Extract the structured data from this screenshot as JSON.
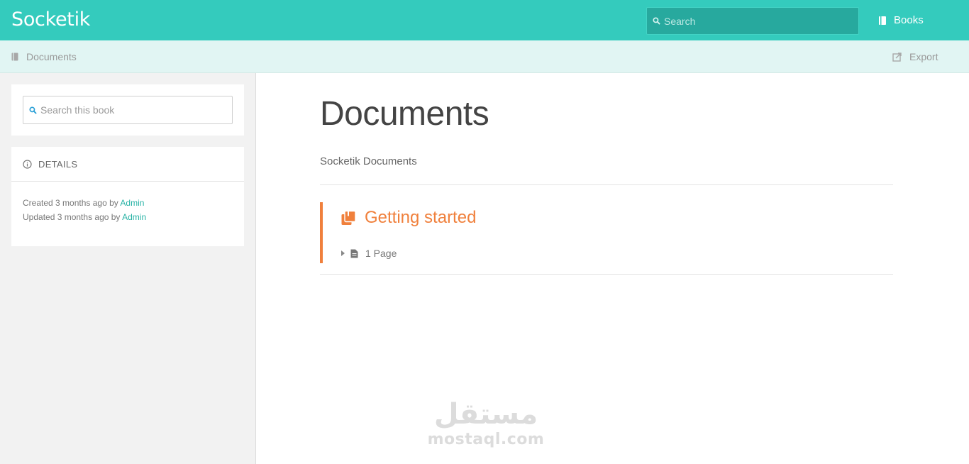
{
  "header": {
    "logo": "Socketik",
    "search_placeholder": "Search",
    "nav_books": "Books"
  },
  "toolbar": {
    "breadcrumb": "Documents",
    "export_label": "Export"
  },
  "sidebar": {
    "search_placeholder": "Search this book",
    "details_title": "DETAILS",
    "created_prefix": "Created 3 months ago by",
    "created_by": "Admin",
    "updated_prefix": "Updated 3 months ago by",
    "updated_by": "Admin"
  },
  "main": {
    "title": "Documents",
    "description": "Socketik Documents",
    "chapter": {
      "title": "Getting started",
      "pages_label": "1 Page"
    }
  },
  "watermark": {
    "arabic": "مستقل",
    "latin": "mostaql.com"
  },
  "colors": {
    "header_bg": "#34cbbd",
    "toolbar_bg": "#e1f5f3",
    "chapter_accent": "#f0803c",
    "link": "#29b3a6"
  },
  "icons": {
    "search": "search-icon",
    "book": "book-icon",
    "export": "export-icon",
    "info": "info-icon",
    "chapter": "chapter-icon",
    "page": "page-icon",
    "caret": "caret-right-icon"
  }
}
